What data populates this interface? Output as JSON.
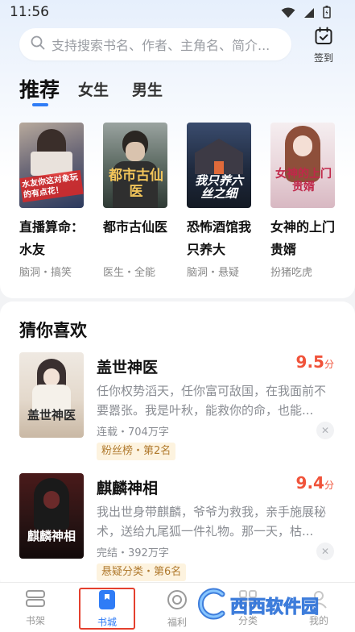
{
  "status_bar": {
    "time": "11:56"
  },
  "search": {
    "placeholder": "支持搜索书名、作者、主角名、简介..."
  },
  "signin": {
    "label": "签到"
  },
  "tabs": [
    {
      "label": "推荐",
      "active": true
    },
    {
      "label": "女生",
      "active": false
    },
    {
      "label": "男生",
      "active": false
    }
  ],
  "recommended": [
    {
      "title": "直播算命：水友",
      "tags": "脑洞・搞笑",
      "cover_text": "水友你这对象玩的有点花！"
    },
    {
      "title": "都市古仙医",
      "tags": "医生・全能",
      "cover_text": "都市古仙医"
    },
    {
      "title": "恐怖酒馆我只养大",
      "tags": "脑洞・悬疑",
      "cover_text": "我只养六丝之细"
    },
    {
      "title": "女神的上门贵婿",
      "tags": "扮猪吃虎",
      "cover_text": "女神的上门贵婿"
    }
  ],
  "guess": {
    "title": "猜你喜欢",
    "books": [
      {
        "name": "盖世神医",
        "score": "9.5",
        "score_unit": "分",
        "desc": "任你权势滔天，任你富可敌国，在我面前不要嚣张。我是叶秋，能救你的命，也能...",
        "meta": "连载・704万字",
        "rank": "粉丝榜・第2名",
        "cover_text": "盖世神医"
      },
      {
        "name": "麒麟神相",
        "score": "9.4",
        "score_unit": "分",
        "desc": "我出世身带麒麟，爷爷为救我，亲手施展秘术，送给九尾狐一件礼物。那一天，枯...",
        "meta": "完结・392万字",
        "rank": "悬疑分类・第6名",
        "cover_text": "麒麟神相"
      }
    ]
  },
  "bottom_nav": [
    {
      "label": "书架",
      "active": false
    },
    {
      "label": "书城",
      "active": true
    },
    {
      "label": "福利",
      "active": false
    },
    {
      "label": "分类",
      "active": false
    },
    {
      "label": "我的",
      "active": false
    }
  ],
  "watermark": {
    "text": "西西软件园"
  },
  "colors": {
    "accent": "#2f7cf6",
    "score": "#f0533a",
    "rank_bg": "#fdf3df",
    "rank_text": "#b07a2e"
  }
}
